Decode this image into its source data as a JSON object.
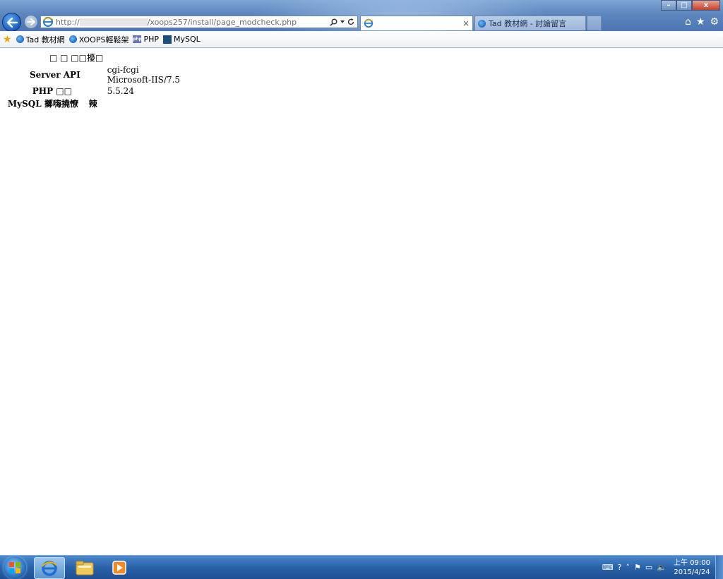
{
  "browser": {
    "address": {
      "prefix": "http://",
      "path": "/xoops257/install/page_modcheck.php"
    },
    "tabs": [
      {
        "label": "",
        "active": true
      },
      {
        "label": "Tad 教材網 - 討論留言",
        "active": false
      }
    ],
    "window_controls": {
      "minimize": "–",
      "maximize": "□",
      "close": "x"
    }
  },
  "favorites": [
    {
      "label": "Tad 教材網",
      "icon": "ie-icon"
    },
    {
      "label": "XOOPS輕鬆架",
      "icon": "ie-icon"
    },
    {
      "label": "PHP",
      "icon": "php-icon"
    },
    {
      "label": "MySQL",
      "icon": "mysql-icon"
    }
  ],
  "page": {
    "rows": [
      {
        "label": "□  □  □□擾□",
        "value": ""
      },
      {
        "label": "Server API",
        "value_lines": [
          "cgi-fcgi",
          "Microsoft-IIS/7.5"
        ]
      },
      {
        "label": "PHP □□",
        "value": "5.5.24"
      },
      {
        "label": "MySQL 擲嗨撓憭",
        "value": "辣"
      }
    ]
  },
  "taskbar": {
    "clock_time": "上午 09:00",
    "clock_date": "2015/4/24"
  },
  "colors": {
    "chrome": "#5d86bf",
    "taskbar": "#2a62a8",
    "close_button": "#c2402a"
  }
}
